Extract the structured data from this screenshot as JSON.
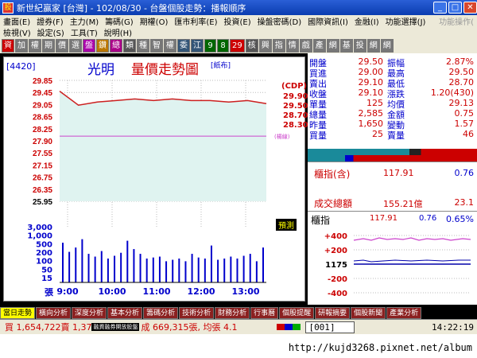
{
  "window": {
    "icon_label": "股",
    "title": "新世紀贏家 [台灣] - 102/08/30 - 台盤個股走勢：播報順序"
  },
  "menu": {
    "row1": [
      "畫面(E)",
      "證券(F)",
      "主力(M)",
      "籌碼(G)",
      "期權(O)",
      "匯市利率(E)",
      "投資(E)",
      "操盤密碼(D)",
      "國際資訊(I)",
      "金融(I)",
      "功能選擇(J)"
    ],
    "row1_right": "功能操作(",
    "row2": [
      "檢視(V)",
      "設定(S)",
      "工具(T)",
      "說明(H)"
    ]
  },
  "toolbar": [
    "資",
    "加",
    "權",
    "期",
    "價",
    "選",
    "盤",
    "鑽",
    "總",
    "類",
    "種",
    "智",
    "權",
    "委",
    "江",
    "9",
    "8",
    "29",
    "核",
    "興",
    "指",
    "情",
    "戲",
    "產",
    "網",
    "基",
    "投",
    "網",
    "網"
  ],
  "stock": {
    "code": "[4420]",
    "name": "光明",
    "chart_title": "量價走勢圖",
    "badge": "[紙布]"
  },
  "price_axis": [
    "29.85",
    "29.45",
    "29.05",
    "28.65",
    "28.25",
    "27.90",
    "27.55",
    "27.15",
    "26.75",
    "26.35",
    "25.95"
  ],
  "volume_axis": [
    "3,000",
    "1,000",
    "500",
    "200",
    "100",
    "50",
    "15"
  ],
  "volume_unit": "張",
  "cdp": {
    "label": "(CDP)",
    "values": [
      "29.90",
      "29.50",
      "28.70",
      "28.30"
    ]
  },
  "avg_tag": "(楊線)",
  "forecast_btn": "預測",
  "time_axis": [
    "9:00",
    "10:00",
    "11:00",
    "12:00",
    "13:00"
  ],
  "quote": {
    "left": [
      {
        "label": "開盤",
        "value": "29.50"
      },
      {
        "label": "買進",
        "value": "29.00"
      },
      {
        "label": "賣出",
        "value": "29.10"
      },
      {
        "label": "收盤",
        "value": "29.10"
      },
      {
        "label": "單量",
        "value": "125"
      },
      {
        "label": "總量",
        "value": "2,585"
      },
      {
        "label": "昨量",
        "value": "1,650"
      },
      {
        "label": "買量",
        "value": "25"
      }
    ],
    "right": [
      {
        "label": "振幅",
        "value": "2.87%"
      },
      {
        "label": "最高",
        "value": "29.50"
      },
      {
        "label": "最低",
        "value": "28.70"
      },
      {
        "label": "漲跌",
        "value": "1.20(430)"
      },
      {
        "label": "均價",
        "value": "29.13"
      },
      {
        "label": "金額",
        "value": "0.75"
      },
      {
        "label": "變動",
        "value": "1.57"
      },
      {
        "label": "賣量",
        "value": "46"
      }
    ]
  },
  "index_box": {
    "label": "櫃指(含)",
    "value": "117.91",
    "change": "0.76",
    "turnover_label": "成交總額",
    "turnover": "155.21億",
    "turnover2": "23.1"
  },
  "mini": {
    "label": "櫃指",
    "value": "117.91",
    "value_frac": "91",
    "change": "0.76",
    "pct": "0.65%",
    "axis": [
      "+400",
      "+200",
      "1175",
      "-200",
      "-400"
    ]
  },
  "tabs": [
    "當日走勢",
    "橫向分析",
    "深度分析",
    "基本分析",
    "籌碼分析",
    "技術分析",
    "財務分析",
    "行事曆",
    "個股提醒",
    "研報摘要",
    "個股新聞",
    "產業分析"
  ],
  "statusbar": {
    "left": "買 1,654,722賣 1,37",
    "mid_badge": "融資融券開放股盤",
    "right": "成 669,315張, 均張 4.1",
    "code": "001",
    "time": "14:22:19"
  },
  "url": "http://kujd3268.pixnet.net/album",
  "colors": {
    "up": "#ff0000",
    "down": "#00aa00",
    "label": "#0000cc",
    "panel_bg": "#e6f7f7",
    "line": "#cc2020",
    "avg": "#cc44cc"
  },
  "chart_data": {
    "type": "line",
    "title": "量價走勢圖",
    "ylim": [
      25.95,
      29.85
    ],
    "x": [
      "9:00",
      "10:00",
      "11:00",
      "12:00",
      "13:00"
    ],
    "series": [
      {
        "values": [
          29.5,
          29.05,
          29.15,
          29.2,
          29.25,
          29.2,
          29.25,
          29.2,
          29.2,
          29.15,
          29.2,
          29.1
        ]
      }
    ],
    "volume": [
      300,
      80,
      150,
      500,
      60,
      40,
      90,
      30,
      45,
      70,
      400,
      120,
      60,
      30,
      35,
      40,
      20,
      25,
      30,
      20,
      60,
      35,
      30,
      200,
      25,
      30,
      40,
      30,
      45,
      60,
      20,
      150
    ]
  }
}
